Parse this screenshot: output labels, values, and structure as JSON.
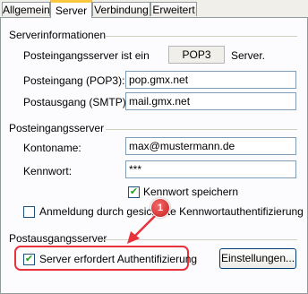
{
  "tabs": [
    "Allgemein",
    "Server",
    "Verbindung",
    "Erweitert"
  ],
  "server_info": {
    "title": "Serverinformationen",
    "incoming_type_label": "Posteingangsserver ist ein",
    "incoming_type_value": "POP3",
    "incoming_type_suffix": "Server.",
    "pop3_label": "Posteingang (POP3):",
    "pop3_value": "pop.gmx.net",
    "smtp_label": "Postausgang (SMTP):",
    "smtp_value": "mail.gmx.net"
  },
  "incoming": {
    "title": "Posteingangsserver",
    "account_label": "Kontoname:",
    "account_value": "max@mustermann.de",
    "password_label": "Kennwort:",
    "password_value": "***",
    "save_password_label": "Kennwort speichern",
    "save_password_checked": true,
    "spa_label": "Anmeldung durch gesicherte Kennwortauthentifizierung",
    "spa_checked": false
  },
  "outgoing": {
    "title": "Postausgangsserver",
    "auth_label": "Server erfordert Authentifizierung",
    "auth_checked": true,
    "settings_button": "Einstellungen..."
  },
  "annotation": {
    "badge_number": "1",
    "highlight_color": "#e8323c"
  }
}
